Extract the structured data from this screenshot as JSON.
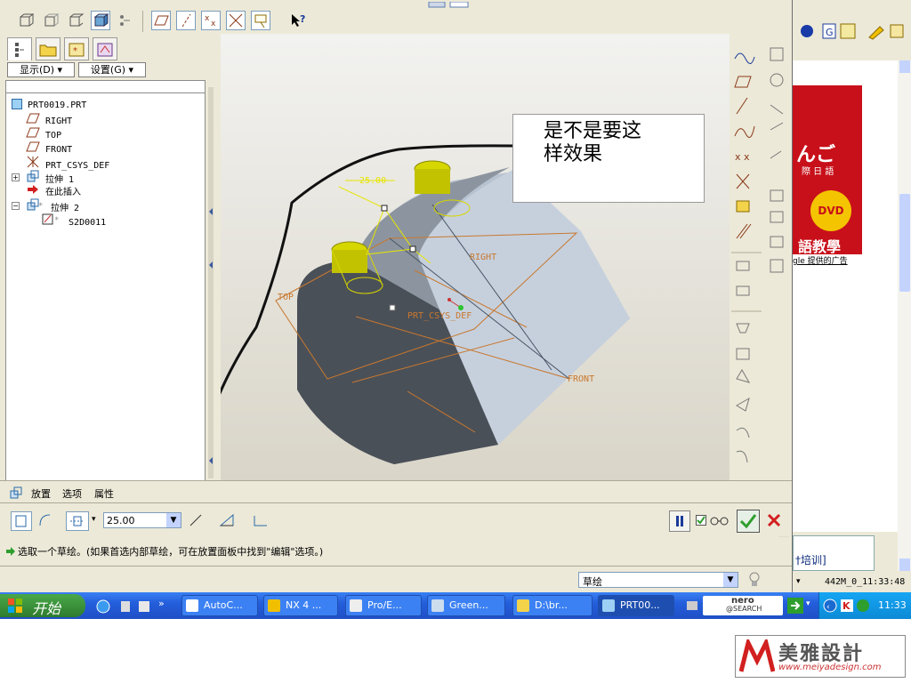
{
  "model_tree": {
    "display_label": "显示(D)",
    "settings_label": "设置(G)",
    "nodes": [
      {
        "label": "PRT0019.PRT",
        "indent": 0
      },
      {
        "label": "RIGHT",
        "indent": 1
      },
      {
        "label": "TOP",
        "indent": 1
      },
      {
        "label": "FRONT",
        "indent": 1
      },
      {
        "label": "PRT_CSYS_DEF",
        "indent": 1
      },
      {
        "label": "拉伸 1",
        "indent": 1
      },
      {
        "label": "在此插入",
        "indent": 1
      },
      {
        "label": "拉伸 2",
        "indent": 1
      },
      {
        "label": "S2D0011",
        "indent": 2
      }
    ]
  },
  "viewport": {
    "dimension": "25.00",
    "datum_labels": {
      "right": "RIGHT",
      "top": "TOP",
      "front": "FRONT",
      "csys": "PRT_CSYS_DEF"
    },
    "note_line1": "是不是要这",
    "note_line2": "样效果"
  },
  "dashboard": {
    "tabs": [
      "放置",
      "选项",
      "属性"
    ],
    "depth_value": "25.00"
  },
  "message": "选取一个草绘。(如果首选内部草绘，可在放置面板中找到\"编辑\"选项。)",
  "status": {
    "filter": "草绘"
  },
  "browser": {
    "banner_text1": "んご",
    "banner_text2": "際 日 語",
    "banner_dvd": "DVD",
    "banner_bottom": "語教學",
    "banner_caption": "gle 提供的广告",
    "link_text": "†培训]",
    "status_text": "442M_0_11:33:48"
  },
  "taskbar": {
    "start_label": "开始",
    "tasks": [
      "AutoC...",
      "NX 4 ...",
      "Pro/E...",
      "Green...",
      "D:\\br...",
      "PRT00..."
    ],
    "nero_label": "nero",
    "nero_sub": "@SEARCH",
    "clock": "11:33"
  },
  "watermark": {
    "logo_text": "美雅設計",
    "url": "www.meiyadesign.com"
  },
  "colors": {
    "accent_yellow": "#d6d600",
    "datum_orange": "#c8782e",
    "taskbar_blue": "#245edb",
    "ok_green": "#2e9e2e",
    "cancel_red": "#d21f1f"
  }
}
